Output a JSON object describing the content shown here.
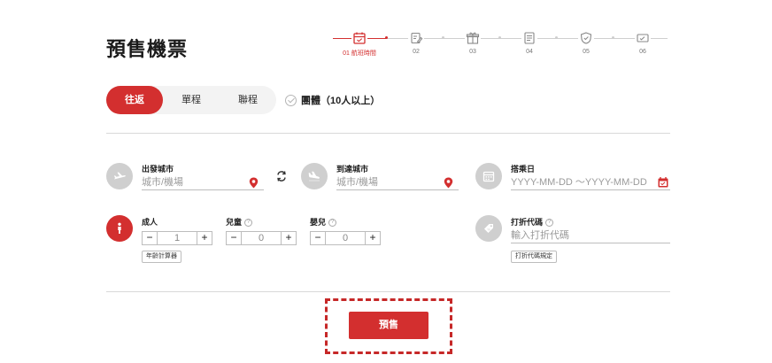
{
  "page": {
    "title": "預售機票"
  },
  "stepper": {
    "steps": [
      {
        "label": "01 航班時間",
        "icon": "calendar-icon"
      },
      {
        "label": "02",
        "icon": "edit-icon"
      },
      {
        "label": "03",
        "icon": "gift-icon"
      },
      {
        "label": "04",
        "icon": "document-icon"
      },
      {
        "label": "05",
        "icon": "shield-icon"
      },
      {
        "label": "06",
        "icon": "ticket-icon"
      }
    ]
  },
  "trip_tabs": [
    {
      "label": "往返",
      "active": true
    },
    {
      "label": "單程",
      "active": false
    },
    {
      "label": "聯程",
      "active": false
    }
  ],
  "group_option": {
    "label": "團體（10人以上）"
  },
  "origin": {
    "label": "出發城市",
    "placeholder": "城市/機場"
  },
  "destination": {
    "label": "到達城市",
    "placeholder": "城市/機場"
  },
  "dates": {
    "label": "搭乘日",
    "placeholder": "YYYY-MM-DD ～YYYY-MM-DD"
  },
  "passengers": {
    "adult": {
      "label": "成人",
      "value": "1"
    },
    "child": {
      "label": "兒童",
      "value": "0"
    },
    "infant": {
      "label": "嬰兒",
      "value": "0"
    },
    "age_calc_label": "年齡計算器",
    "minus": "−",
    "plus": "+"
  },
  "promo": {
    "label": "打折代碼",
    "placeholder": "輸入打折代碼",
    "rules_label": "打折代碼規定"
  },
  "submit": {
    "label": "預售"
  },
  "help_glyph": "?",
  "colors": {
    "accent": "#d32f2f",
    "icon_bg": "#cfcfcf"
  }
}
